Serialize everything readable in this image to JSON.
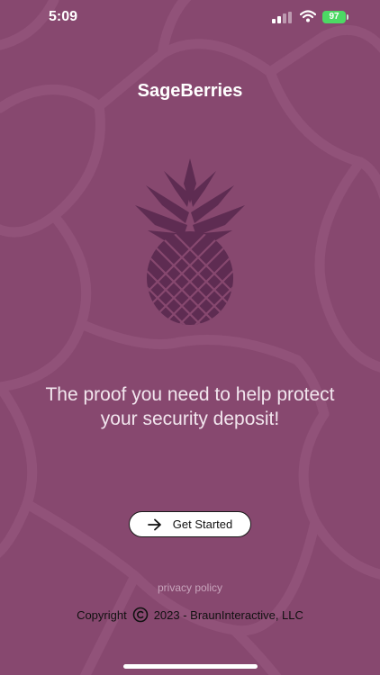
{
  "status_bar": {
    "time": "5:09",
    "battery_level": "97",
    "icons": [
      "cellular-signal-icon",
      "wifi-icon",
      "battery-charging-icon"
    ]
  },
  "app": {
    "title": "SageBerries",
    "logo": "pineapple-icon"
  },
  "tagline": "The proof you need to help protect your security deposit!",
  "cta": {
    "label": "Get Started",
    "icon": "arrow-right-icon"
  },
  "footer": {
    "privacy_label": "privacy policy",
    "copyright_word": "Copyright",
    "copyright_icon": "copyright-icon",
    "copyright_rest": "2023 - BraunInteractive, LLC"
  },
  "colors": {
    "background": "#87486f",
    "pattern": "#9a5b82",
    "logo": "#5e2c52",
    "battery": "#4cd964",
    "button_bg": "#ffffff"
  }
}
